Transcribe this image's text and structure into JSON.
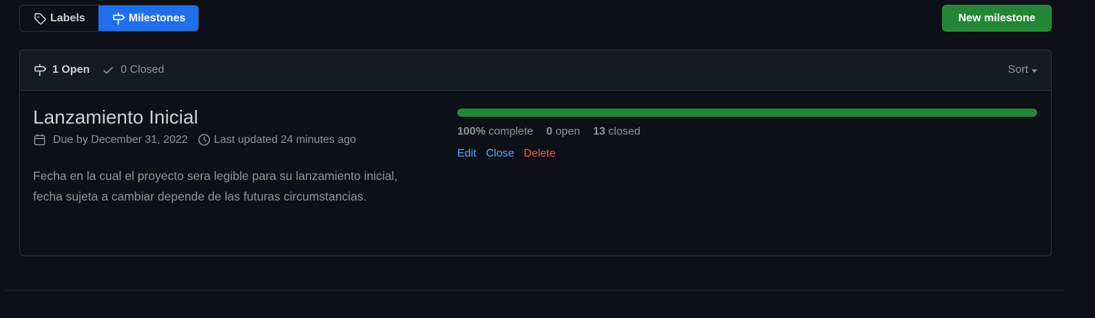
{
  "subnav": {
    "labels": "Labels",
    "milestones": "Milestones"
  },
  "new_milestone_button": "New milestone",
  "states": {
    "open": "1 Open",
    "closed": "0 Closed"
  },
  "sort_label": "Sort",
  "milestone": {
    "title": "Lanzamiento Inicial",
    "due": "Due by December 31, 2022",
    "updated": "Last updated 24 minutes ago",
    "description": "Fecha en la cual el proyecto sera legible para su lanzamiento inicial, fecha sujeta a cambiar depende de las futuras circumstancias.",
    "progress_fraction": 1.0,
    "complete_value": "100%",
    "complete_label": "complete",
    "open_count": "0",
    "open_label": "open",
    "closed_count": "13",
    "closed_label": "closed",
    "actions": {
      "edit": "Edit",
      "close": "Close",
      "delete": "Delete"
    }
  },
  "icons": {
    "labels": "tag-icon",
    "milestones": "milestone-icon",
    "open_state": "milestone-icon",
    "closed_state": "check-icon",
    "due": "calendar-icon",
    "updated": "clock-icon"
  },
  "colors": {
    "background": "#0d1117",
    "header_bg": "#161b22",
    "selected_tab": "#1f6feb",
    "primary_button": "#238636",
    "progress": "#238636",
    "link": "#58a6ff",
    "danger": "#f85149"
  }
}
